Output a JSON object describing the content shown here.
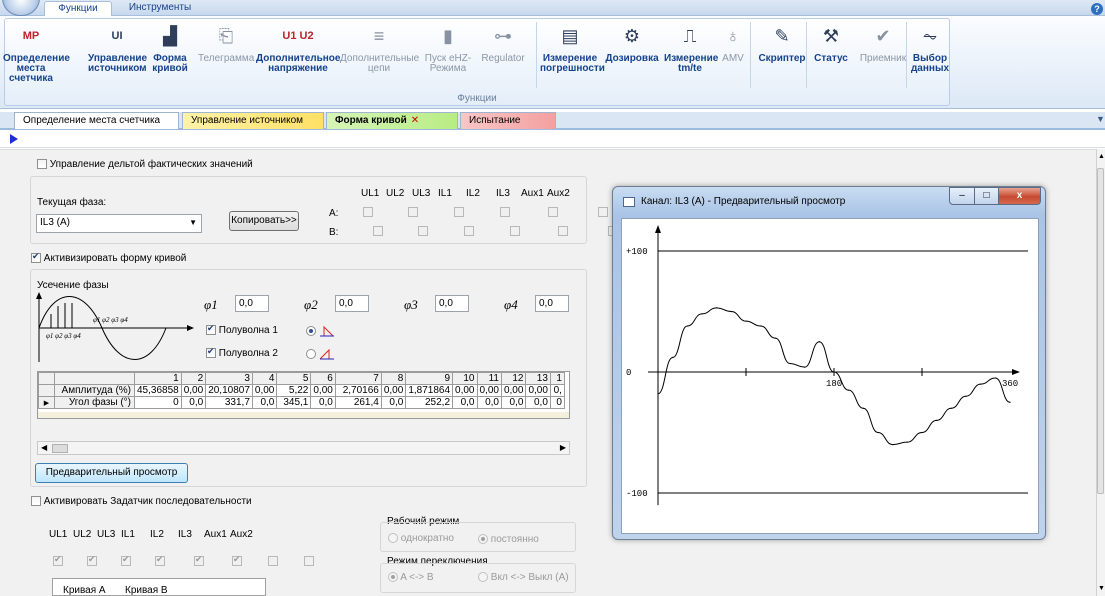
{
  "ribbon": {
    "tabs": [
      "Функции",
      "Инструменты"
    ],
    "group_label": "Функции",
    "buttons": [
      {
        "label": "Определение места счетчика",
        "icon": "mp-icon",
        "glyph": "MP",
        "disabled": false
      },
      {
        "label": "Управление источником",
        "icon": "source-control-icon",
        "glyph": "UI",
        "disabled": false
      },
      {
        "label": "Форма кривой",
        "icon": "waveform-icon",
        "glyph": "▟",
        "disabled": false
      },
      {
        "label": "Телеграмма",
        "icon": "telegram-icon",
        "glyph": "⎗",
        "disabled": true
      },
      {
        "label": "Дополнительное напряжение",
        "icon": "add-voltage-icon",
        "glyph": "U1 U2",
        "disabled": false
      },
      {
        "label": "Дополнительные цепи",
        "icon": "add-circuits-icon",
        "glyph": "≡",
        "disabled": true
      },
      {
        "label": "Пуск eHZ-Режима",
        "icon": "ehz-start-icon",
        "glyph": "▮",
        "disabled": true
      },
      {
        "label": "Regulator",
        "icon": "regulator-icon",
        "glyph": "⊶",
        "disabled": true
      },
      {
        "label": "Измерение погрешности",
        "icon": "error-measure-icon",
        "glyph": "▤",
        "disabled": false
      },
      {
        "label": "Дозировка",
        "icon": "dosing-icon",
        "glyph": "⚙",
        "disabled": false
      },
      {
        "label": "Измерение tm/te",
        "icon": "tm-te-icon",
        "glyph": "⎍",
        "disabled": false
      },
      {
        "label": "AMV",
        "icon": "amv-icon",
        "glyph": "♁",
        "disabled": true
      },
      {
        "label": "Скриптер",
        "icon": "scripter-icon",
        "glyph": "✎",
        "disabled": false
      },
      {
        "label": "Статус",
        "icon": "status-icon",
        "glyph": "⚒",
        "disabled": false
      },
      {
        "label": "Приемник",
        "icon": "receiver-icon",
        "glyph": "✔",
        "disabled": true
      },
      {
        "label": "Выбор данных",
        "icon": "data-select-icon",
        "glyph": "⏦",
        "disabled": false
      }
    ]
  },
  "doc_tabs": [
    "Определение места счетчика",
    "Управление источником",
    "Форма кривой",
    "Испытание точности"
  ],
  "delta_checkbox": "Управление дельтой фактических значений",
  "phase": {
    "label": "Текущая фаза:",
    "value": "IL3 (A)",
    "copy_button": "Копировать>>",
    "channels": [
      "UL1",
      "UL2",
      "UL3",
      "IL1",
      "IL2",
      "IL3",
      "Aux1",
      "Aux2"
    ],
    "row_a": "A:",
    "row_b": "B:"
  },
  "activate_waveform": "Активизировать форму кривой",
  "cut": {
    "title": "Усечение фазы",
    "phi": [
      {
        "label": "φ1",
        "value": "0,0"
      },
      {
        "label": "φ2",
        "value": "0,0"
      },
      {
        "label": "φ3",
        "value": "0,0"
      },
      {
        "label": "φ4",
        "value": "0,0"
      }
    ],
    "halfwave1": "Полуволна 1",
    "halfwave2": "Полуволна 2",
    "diagram_top": "φ1 φ2 φ3 φ4",
    "diagram_bottom": "φ1 φ2 φ3 φ4"
  },
  "harmonics": {
    "columns": [
      "",
      "1",
      "2",
      "3",
      "4",
      "5",
      "6",
      "7",
      "8",
      "9",
      "10",
      "11",
      "12",
      "13",
      "1"
    ],
    "amplitude": [
      "Амплитуда (%)",
      "45,36858",
      "0,00",
      "20,10807",
      "0,00",
      "5,22",
      "0,00",
      "2,70166",
      "0,00",
      "1,871864",
      "0,00",
      "0,00",
      "0,00",
      "0,00",
      "0,"
    ],
    "phase_angle": [
      "Угол фазы (°)",
      "0",
      "0,0",
      "331,7",
      "0,0",
      "345,1",
      "0,0",
      "261,4",
      "0,0",
      "252,2",
      "0,0",
      "0,0",
      "0,0",
      "0,0",
      "0"
    ]
  },
  "preview_button": "Предварительный просмотр",
  "sequencer": {
    "checkbox": "Активировать Задатчик последовательности",
    "channels": [
      "UL1",
      "UL2",
      "UL3",
      "IL1",
      "IL2",
      "IL3",
      "Aux1",
      "Aux2"
    ],
    "checked": [
      true,
      true,
      true,
      true,
      true,
      true,
      false,
      false
    ],
    "work_mode_label": "Рабочий режим",
    "mode_once": "однократно",
    "mode_const": "постоянно",
    "switch_mode_label": "Режим переключения",
    "switch_ab": "A <-> B",
    "switch_onoff": "Вкл <-> Выкл (A)",
    "curves": [
      "Кривая А",
      "Кривая В"
    ]
  },
  "preview": {
    "title": "Канал: IL3 (A) - Предварительный просмотр",
    "win_min": "–",
    "win_max": "□",
    "win_close": "x"
  },
  "chart_data": {
    "type": "line",
    "xlim": [
      0,
      360
    ],
    "ylim": [
      -100,
      100
    ],
    "y_ticks": [
      "+100",
      "0",
      "-100"
    ],
    "x_tick_labels": [
      {
        "x": 180,
        "label": "180"
      },
      {
        "x": 360,
        "label": "360"
      }
    ],
    "x": [
      0,
      15,
      30,
      45,
      60,
      75,
      90,
      105,
      120,
      135,
      150,
      165,
      180,
      195,
      210,
      225,
      240,
      255,
      270,
      285,
      300,
      315,
      330,
      345,
      360
    ],
    "y": [
      -18,
      12,
      38,
      48,
      53,
      50,
      42,
      38,
      28,
      7,
      4,
      25,
      0,
      -15,
      -30,
      -50,
      -60,
      -58,
      -50,
      -40,
      -30,
      -20,
      -10,
      -5,
      -25
    ]
  },
  "colors": {
    "accent": "#15428b",
    "plot_line": "#000000"
  }
}
